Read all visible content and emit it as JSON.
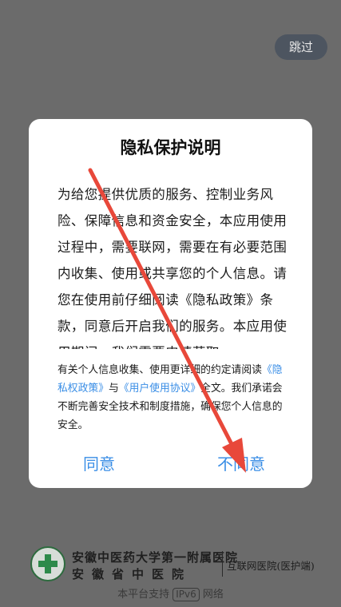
{
  "header": {
    "skip_label": "跳过"
  },
  "dialog": {
    "title": "隐私保护说明",
    "body": "为给您提供优质的服务、控制业务风险、保障信息和资金安全，本应用使用过程中，需要联网，需要在有必要范围内收集、使用或共享您的个人信息。请您在使用前仔细阅读《隐私政策》条款，同意后开启我们的服务。本应用使用期间，我们需要申请获取",
    "notice_prefix": "有关个人信息收集、使用更详细的约定请阅读",
    "privacy_link": "《隐私权政策》",
    "notice_and": "与",
    "terms_link": "《用户使用协议》",
    "notice_suffix": "全文。我们承诺会不断完善安全技术和制度措施，确保您个人信息的安全。",
    "agree_label": "同意",
    "disagree_label": "不同意"
  },
  "footer": {
    "hospital_line1": "安徽中医药大学第一附属医院",
    "hospital_line2": "安徽省中医院",
    "platform_name": "互联网医院(医护端)",
    "ipv6_prefix": "本平台支持",
    "ipv6_badge": "IPv6",
    "ipv6_suffix": "网络"
  },
  "colors": {
    "overlay": "#6b6b6b",
    "link": "#3a8ee6",
    "annotation_arrow": "#e8483a"
  }
}
